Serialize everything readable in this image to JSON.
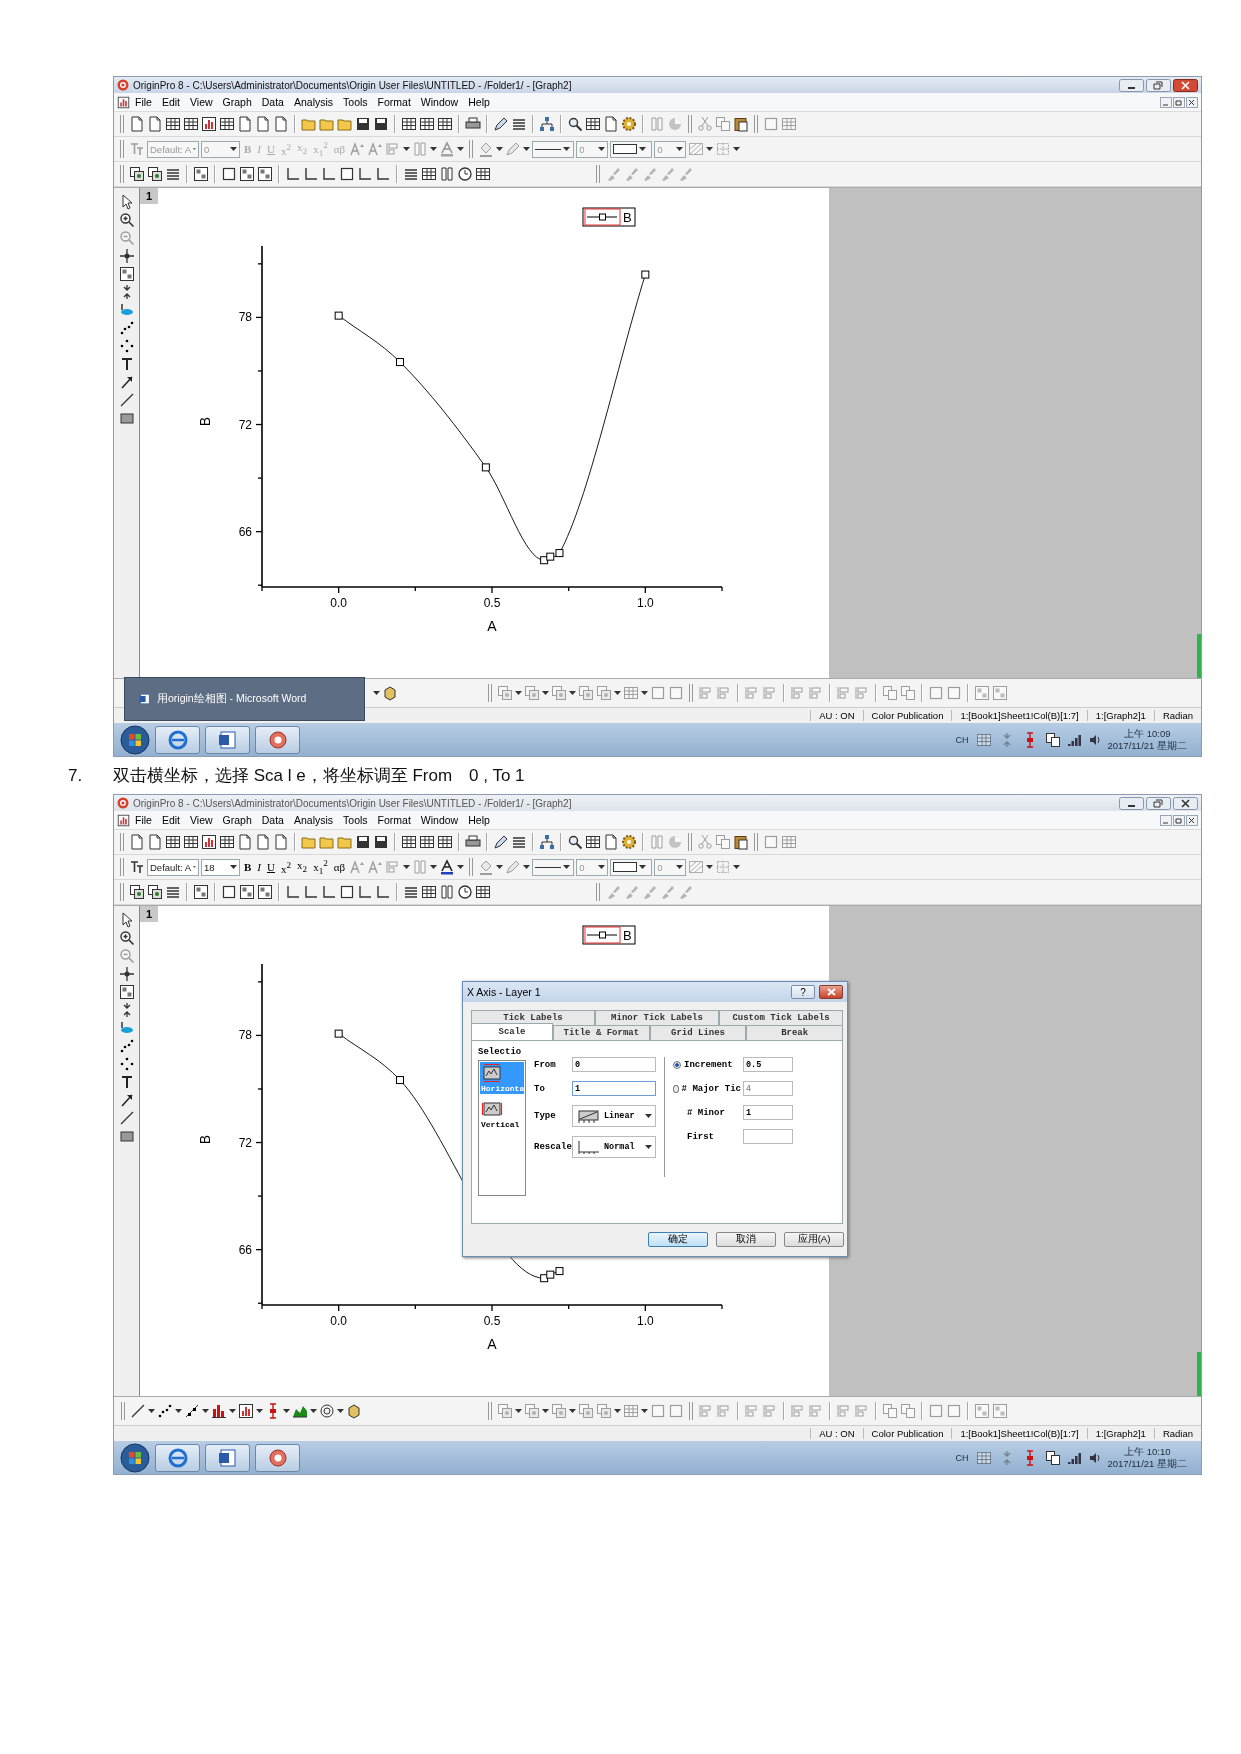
{
  "screens": [
    {
      "window": {
        "title": "OriginPro 8 - C:\\Users\\Administrator\\Documents\\Origin User Files\\UNTITLED - /Folder1/ - [Graph2]",
        "active": true
      },
      "menu": [
        "File",
        "Edit",
        "View",
        "Graph",
        "Data",
        "Analysis",
        "Tools",
        "Format",
        "Window",
        "Help"
      ],
      "format_toolbar": {
        "disabled": true,
        "font": "Default: A",
        "size": "0",
        "style_buttons": [
          {
            "label": "B",
            "kind": "bold"
          },
          {
            "label": "I",
            "kind": "italic"
          },
          {
            "label": "U",
            "kind": "underline"
          },
          {
            "label": "x$^{2}$",
            "kind": "script"
          },
          {
            "label": "x$_{2}$",
            "kind": "script"
          },
          {
            "label": "x$_{1}$$^{2}$",
            "kind": "script"
          },
          {
            "label": "αβ",
            "kind": "greek"
          }
        ],
        "line_fields": [
          "0",
          "0"
        ]
      },
      "graph": {
        "layer": "1",
        "chart_data": {
          "type": "line",
          "xlabel": "A",
          "ylabel": "B",
          "x": [
            0,
            0.2,
            0.48,
            0.67,
            0.69,
            0.72,
            1.0
          ],
          "series": [
            {
              "name": "B",
              "color": "#000000",
              "marker": "square",
              "values": [
                78.1,
                75.5,
                69.6,
                64.4,
                64.6,
                64.8,
                80.4
              ]
            }
          ],
          "xlim": [
            -0.25,
            1.25
          ],
          "ylim": [
            62.9,
            82
          ],
          "xticks": [
            {
              "value": 0,
              "label": "0.0"
            },
            {
              "value": 0.5,
              "label": "0.5"
            },
            {
              "value": 1,
              "label": "1.0"
            }
          ],
          "yticks": [
            66,
            72,
            78
          ]
        }
      },
      "taskbar_preview": {
        "label": "用origin绘相图 - Microsoft Word"
      },
      "status_bar": [
        "AU : ON",
        "Color Publication",
        "1:[Book1]Sheet1!Col(B)[1:7]",
        "1:[Graph2]1",
        "Radian"
      ],
      "taskbar": {
        "language": "CH",
        "time": "上午 10:09",
        "date": "2017/11/21 星期二"
      }
    },
    {
      "window": {
        "title": "OriginPro 8 - C:\\Users\\Administrator\\Documents\\Origin User Files\\UNTITLED - /Folder1/ - [Graph2]",
        "active": false
      },
      "menu": [
        "File",
        "Edit",
        "View",
        "Graph",
        "Data",
        "Analysis",
        "Tools",
        "Format",
        "Window",
        "Help"
      ],
      "format_toolbar": {
        "disabled": false,
        "font": "Default: A",
        "size": "18",
        "style_buttons": [
          {
            "label": "B",
            "kind": "bold"
          },
          {
            "label": "I",
            "kind": "italic"
          },
          {
            "label": "U",
            "kind": "underline"
          },
          {
            "label": "x$^{2}$",
            "kind": "script"
          },
          {
            "label": "x$_{2}$",
            "kind": "script"
          },
          {
            "label": "x$_{1}$$^{2}$",
            "kind": "script"
          },
          {
            "label": "αβ",
            "kind": "greek"
          }
        ],
        "line_fields": [
          "0",
          "0"
        ]
      },
      "graph": {
        "layer": "1",
        "chart_data": {
          "type": "line",
          "xlabel": "A",
          "ylabel": "B",
          "x": [
            0,
            0.2,
            0.67,
            0.69,
            0.72
          ],
          "series": [
            {
              "name": "B",
              "color": "#000000",
              "marker": "square",
              "values": [
                78.1,
                75.5,
                64.4,
                64.6,
                64.8
              ]
            }
          ],
          "xlim": [
            -0.25,
            1.25
          ],
          "ylim": [
            62.9,
            82
          ],
          "xticks": [
            {
              "value": 0,
              "label": "0.0"
            },
            {
              "value": 0.5,
              "label": "0.5"
            },
            {
              "value": 1,
              "label": "1.0"
            }
          ],
          "yticks": [
            66,
            72,
            78
          ]
        }
      },
      "dialog": {
        "title": "X Axis - Layer 1",
        "help": "?",
        "tab_rows": [
          [
            {
              "label": "Tick Labels",
              "selected": false
            },
            {
              "label": "Minor Tick Labels",
              "selected": false
            },
            {
              "label": "Custom Tick Labels",
              "selected": false
            }
          ],
          [
            {
              "label": "Scale",
              "selected": true
            },
            {
              "label": "Title & Format",
              "selected": false
            },
            {
              "label": "Grid Lines",
              "selected": false
            },
            {
              "label": "Break",
              "selected": false
            }
          ]
        ],
        "selection": {
          "label": "Selectio",
          "items": [
            {
              "label": "Horizonta",
              "selected": true
            },
            {
              "label": "Vertical",
              "selected": false
            }
          ]
        },
        "left_fields": [
          {
            "kind": "text",
            "label": "From",
            "value": "0",
            "focused": false
          },
          {
            "kind": "text",
            "label": "To",
            "value": "1",
            "focused": true
          },
          {
            "kind": "dropdown",
            "label": "Type",
            "value": "Linear"
          },
          {
            "kind": "dropdown",
            "label": "Rescale",
            "value": "Normal"
          }
        ],
        "right_fields": [
          {
            "kind": "radio",
            "label": "Increment",
            "value": "0.5",
            "selected": true
          },
          {
            "kind": "radio",
            "label": "# Major Tic",
            "value": "4",
            "selected": false
          },
          {
            "kind": "text",
            "label": "# Minor",
            "value": "1"
          },
          {
            "kind": "text",
            "label": "First"
          }
        ],
        "buttons": [
          {
            "label": "确定",
            "default": true
          },
          {
            "label": "取消",
            "default": false
          },
          {
            "label": "应用(A)",
            "default": false
          }
        ]
      },
      "status_bar": [
        "AU : ON",
        "Color Publication",
        "1:[Book1]Sheet1!Col(B)[1:7]",
        "1:[Graph2]1",
        "Radian"
      ],
      "taskbar": {
        "language": "CH",
        "time": "上午 10:10",
        "date": "2017/11/21 星期二"
      }
    }
  ],
  "instruction": {
    "number": "7.",
    "text": "双击横坐标，选择 Sca l e，将坐标调至 From　0 , To 1"
  }
}
